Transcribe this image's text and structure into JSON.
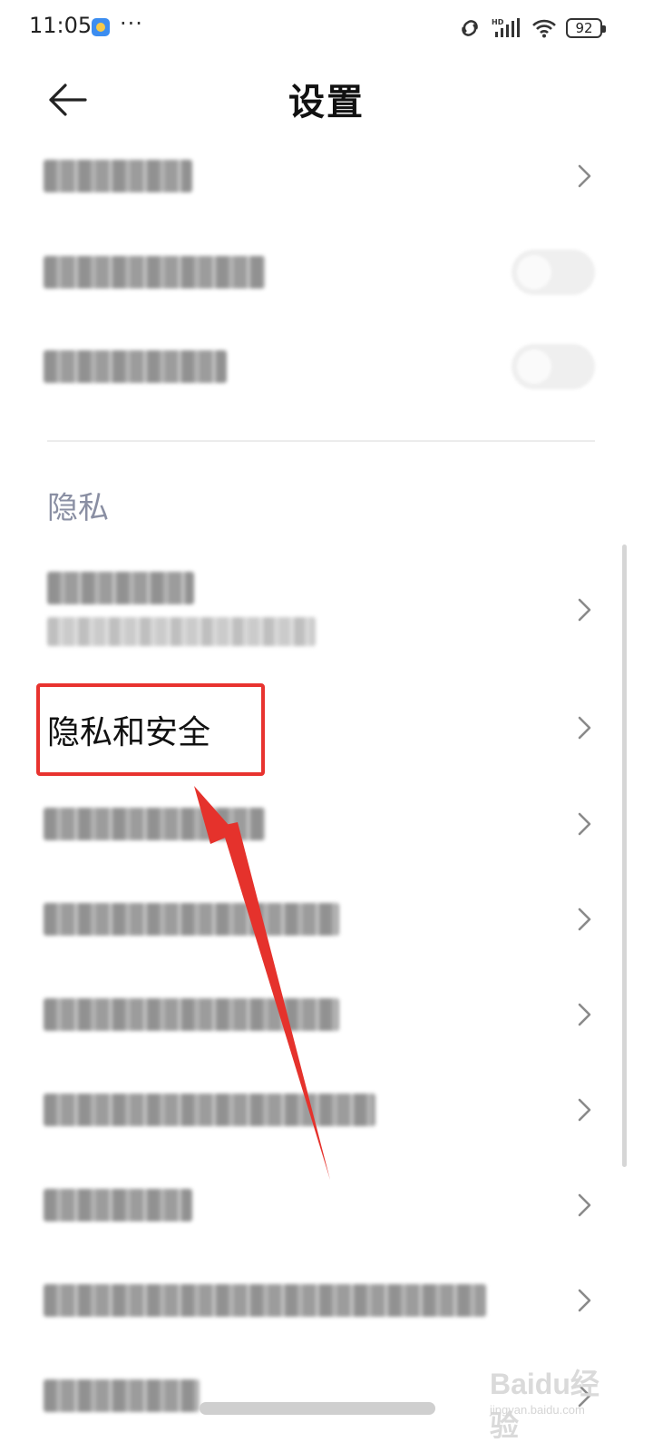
{
  "status_bar": {
    "time": "11:05",
    "more": "···",
    "battery": "92"
  },
  "header": {
    "title": "设置"
  },
  "section": {
    "title": "隐私"
  },
  "highlighted_item": {
    "label": "隐私和安全"
  },
  "watermark": {
    "logo": "Baidu经验",
    "url": "jingyan.baidu.com"
  },
  "colors": {
    "highlight_border": "#e8332f",
    "section_title": "#8a8fa3"
  }
}
